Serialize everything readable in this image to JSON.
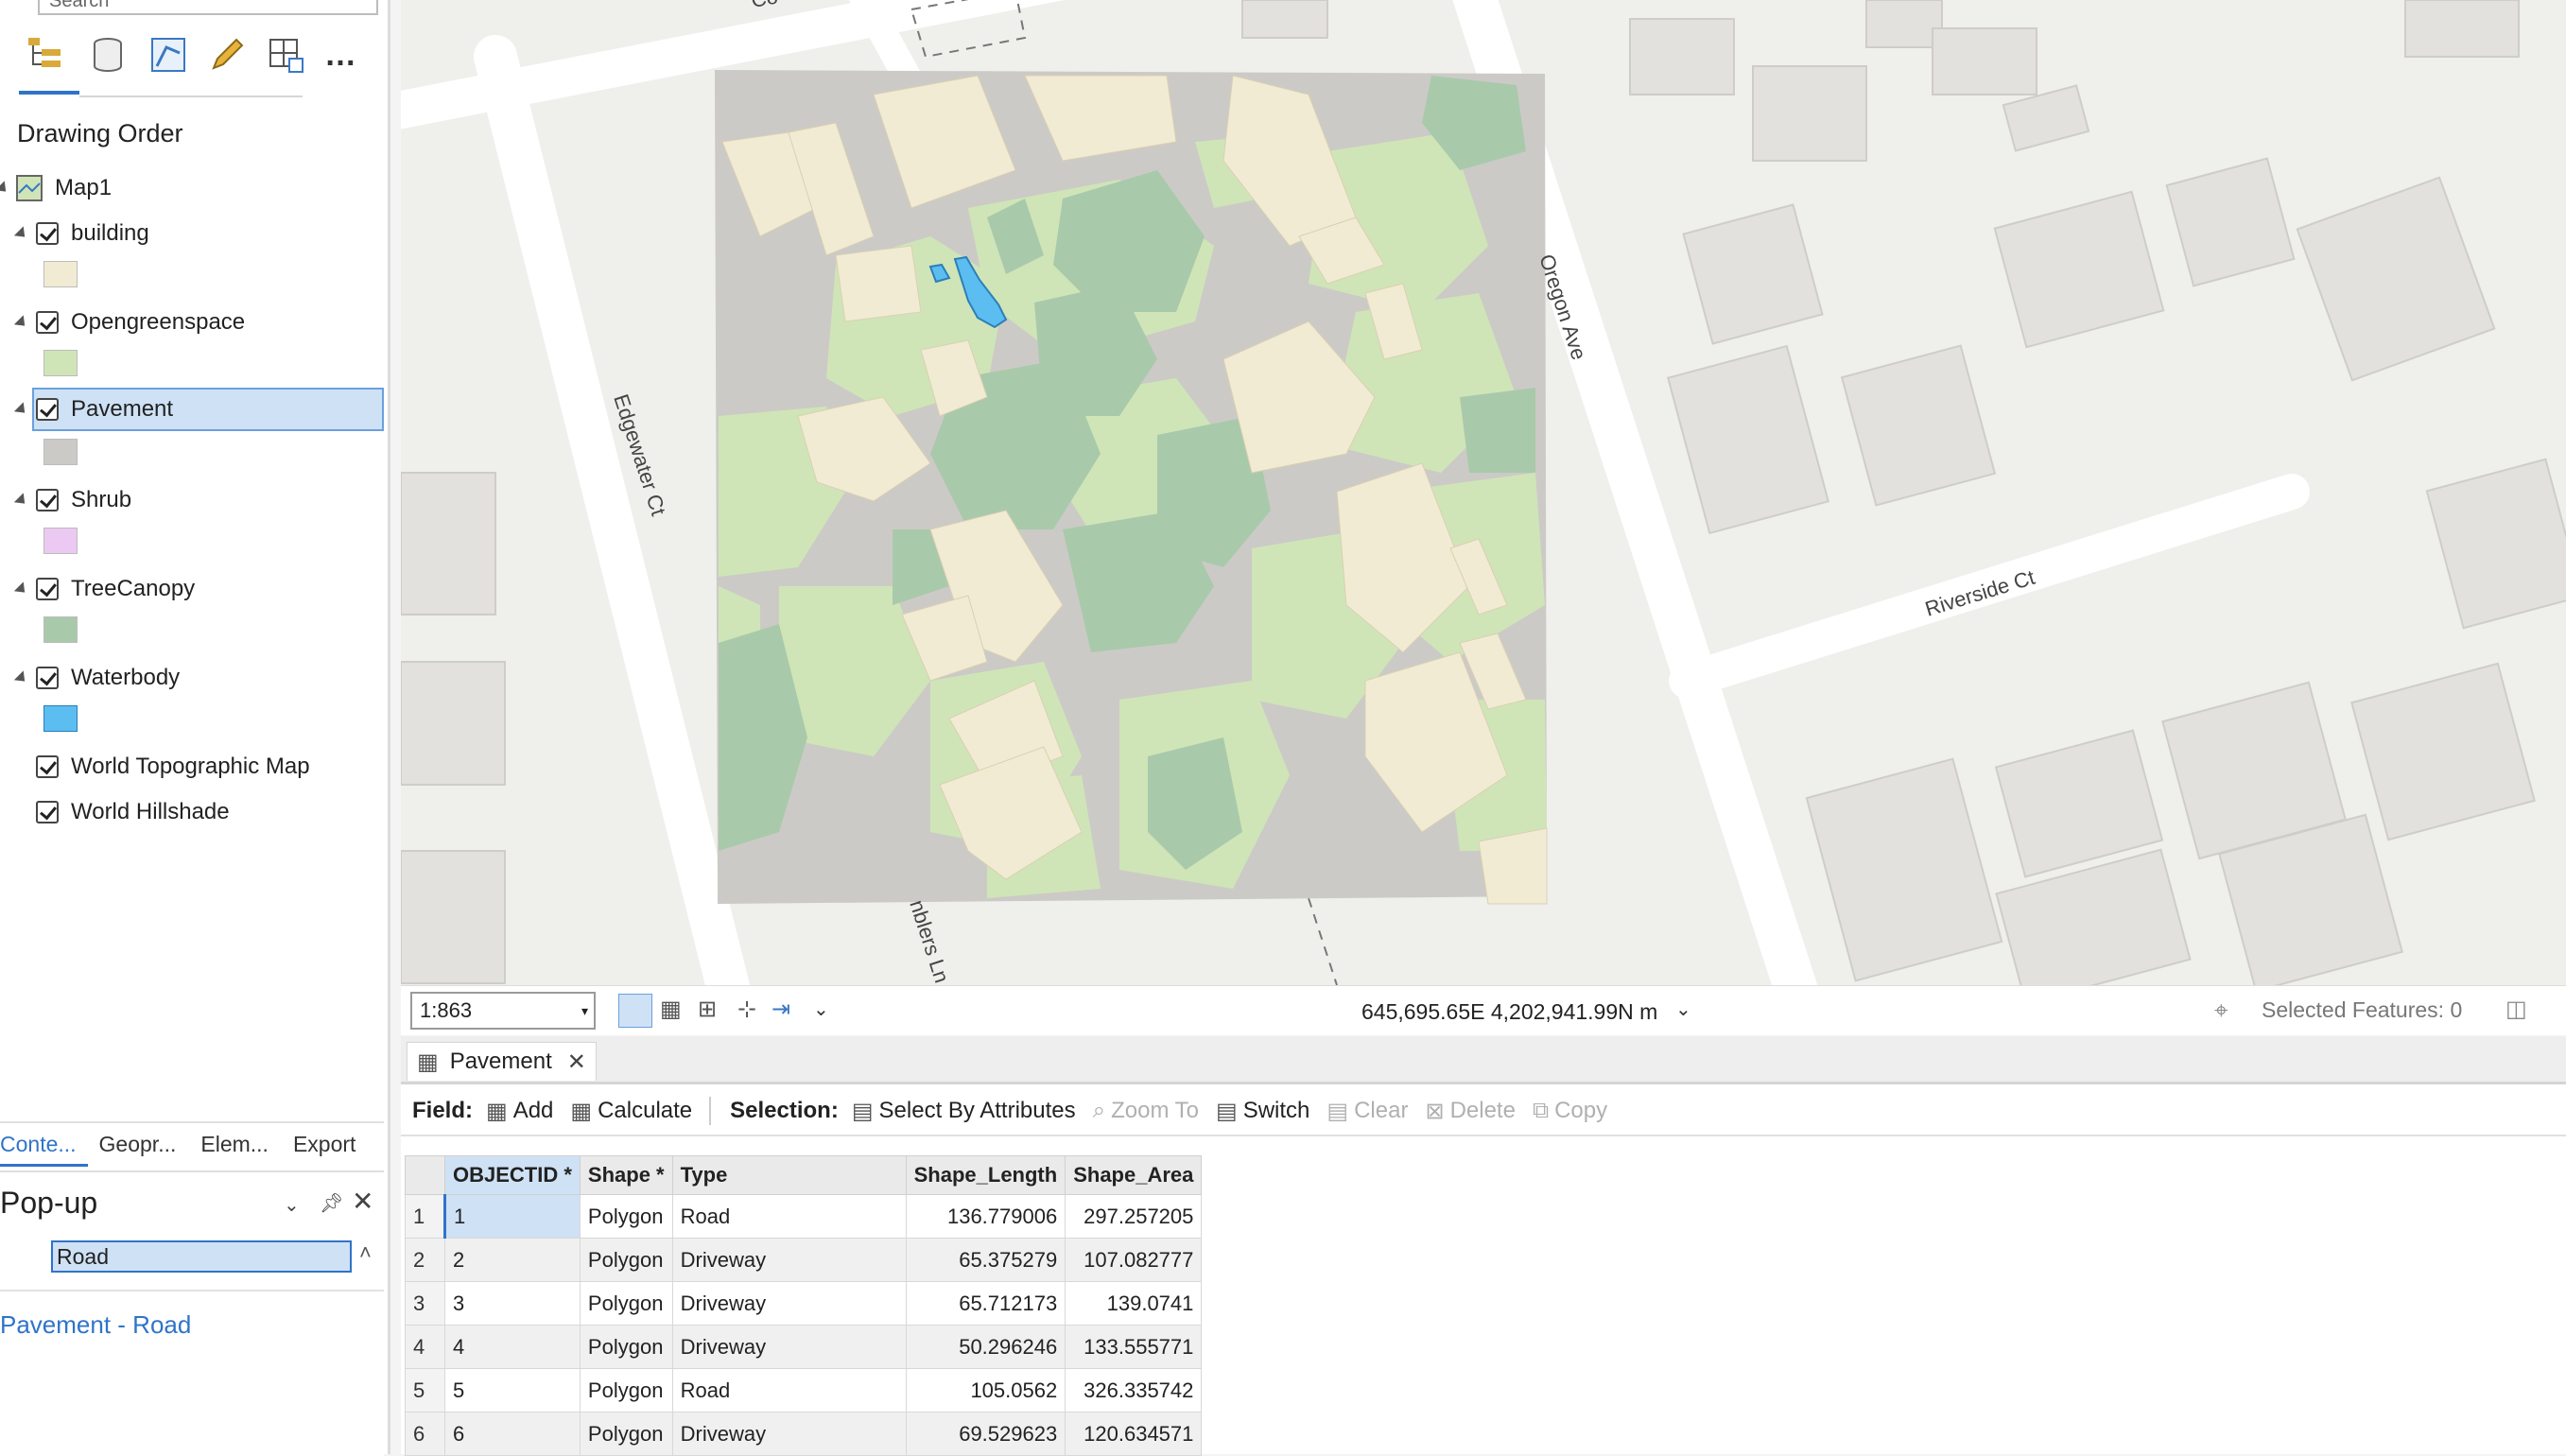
{
  "search_placeholder": "Search",
  "toc_tools": [
    "list-by-drawing-order-icon",
    "list-by-source-icon",
    "list-by-selection-icon",
    "list-by-editing-icon",
    "list-by-snapping-icon",
    "more-icon"
  ],
  "toc_title": "Drawing Order",
  "map_name": "Map1",
  "layers": [
    {
      "name": "building",
      "swatch": "#f2ebd3"
    },
    {
      "name": "Opengreenspace",
      "swatch": "#cfe5b7"
    },
    {
      "name": "Pavement",
      "swatch": "#cccac6"
    },
    {
      "name": "Shrub",
      "swatch": "#ecc9f2"
    },
    {
      "name": "TreeCanopy",
      "swatch": "#a9c9ab"
    },
    {
      "name": "Waterbody",
      "swatch": "#5cbdf0"
    },
    {
      "name": "World Topographic Map",
      "swatch": ""
    },
    {
      "name": "World Hillshade",
      "swatch": ""
    }
  ],
  "left_tabs": [
    "Conte...",
    "Geopr...",
    "Elem...",
    "Export"
  ],
  "popup": {
    "title": "Pop-up",
    "value": "Road",
    "link": "Pavement - Road"
  },
  "map_labels": {
    "street1": "Edgewater Ct",
    "street2": "Oregon Ave",
    "street3": "Riverside Ct",
    "street4": "nblers Ln",
    "street5": "Co"
  },
  "status": {
    "scale": "1:863",
    "coordinates": "645,695.65E 4,202,941.99N m",
    "selected_features": "Selected Features: 0"
  },
  "table": {
    "tab_name": "Pavement",
    "field_label": "Field:",
    "add": "Add",
    "calculate": "Calculate",
    "selection_label": "Selection:",
    "select_by_attributes": "Select By Attributes",
    "zoom_to": "Zoom To",
    "switch": "Switch",
    "clear": "Clear",
    "delete": "Delete",
    "copy": "Copy",
    "columns": [
      "OBJECTID *",
      "Shape *",
      "Type",
      "Shape_Length",
      "Shape_Area"
    ],
    "rows": [
      {
        "n": "1",
        "id": "1",
        "shape": "Polygon",
        "type": "Road",
        "len": "136.779006",
        "area": "297.257205"
      },
      {
        "n": "2",
        "id": "2",
        "shape": "Polygon",
        "type": "Driveway",
        "len": "65.375279",
        "area": "107.082777"
      },
      {
        "n": "3",
        "id": "3",
        "shape": "Polygon",
        "type": "Driveway",
        "len": "65.712173",
        "area": "139.0741"
      },
      {
        "n": "4",
        "id": "4",
        "shape": "Polygon",
        "type": "Driveway",
        "len": "50.296246",
        "area": "133.555771"
      },
      {
        "n": "5",
        "id": "5",
        "shape": "Polygon",
        "type": "Road",
        "len": "105.0562",
        "area": "326.335742"
      },
      {
        "n": "6",
        "id": "6",
        "shape": "Polygon",
        "type": "Driveway",
        "len": "69.529623",
        "area": "120.634571"
      }
    ]
  }
}
